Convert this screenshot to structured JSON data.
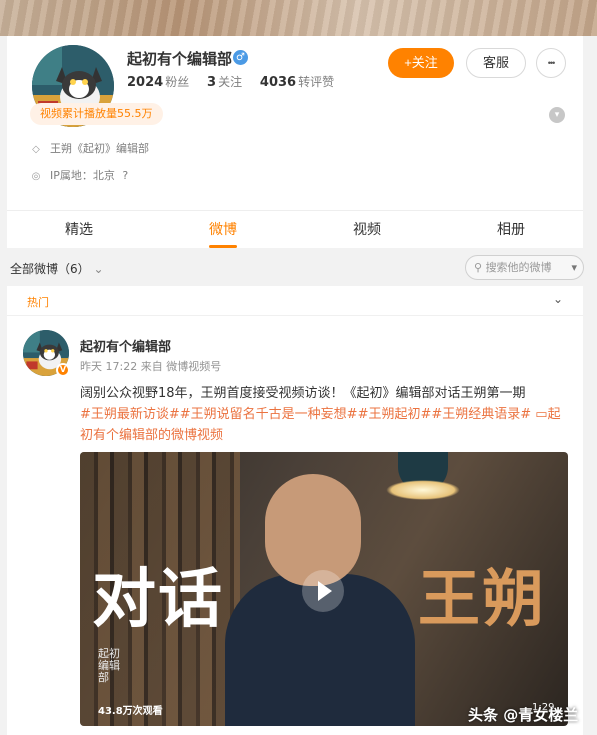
{
  "profile": {
    "username": "起初有个编辑部",
    "gender": "♂",
    "stats": [
      {
        "value": "2024",
        "label": "粉丝"
      },
      {
        "value": "3",
        "label": "关注"
      },
      {
        "value": "4036",
        "label": "转评赞"
      }
    ],
    "follow_label": "+关注",
    "service_label": "客服",
    "more_label": "•••",
    "playcount_badge": "视频累计播放量55.5万",
    "description": "王朔《起初》编辑部",
    "ip_location": "IP属地：北京"
  },
  "tabs": [
    {
      "label": "精选"
    },
    {
      "label": "微博"
    },
    {
      "label": "视频"
    },
    {
      "label": "相册"
    }
  ],
  "filter": {
    "label": "全部微博（6）",
    "search_placeholder": "搜索他的微博"
  },
  "feed": {
    "hot_label": "热门",
    "post": {
      "author": "起初有个编辑部",
      "meta": "昨天 17:22  来自 微博视频号",
      "text": "阔别公众视野18年，王朔首度接受视频访谈！《起初》编辑部对话王朔第一期",
      "tags": "#王朔最新访谈##王朔说留名千古是一种妄想##王朔起初##王朔经典语录#",
      "link_text": "起初有个编辑部的微博视频",
      "video": {
        "title_left": "对话",
        "title_right": "王朔",
        "seal_text": "起初 编辑部",
        "view_count": "43.8万次观看",
        "duration": "1:29"
      }
    }
  },
  "watermark": "头条 @青女楼兰",
  "colors": {
    "accent": "#ff8200",
    "tag": "#eb7340"
  }
}
